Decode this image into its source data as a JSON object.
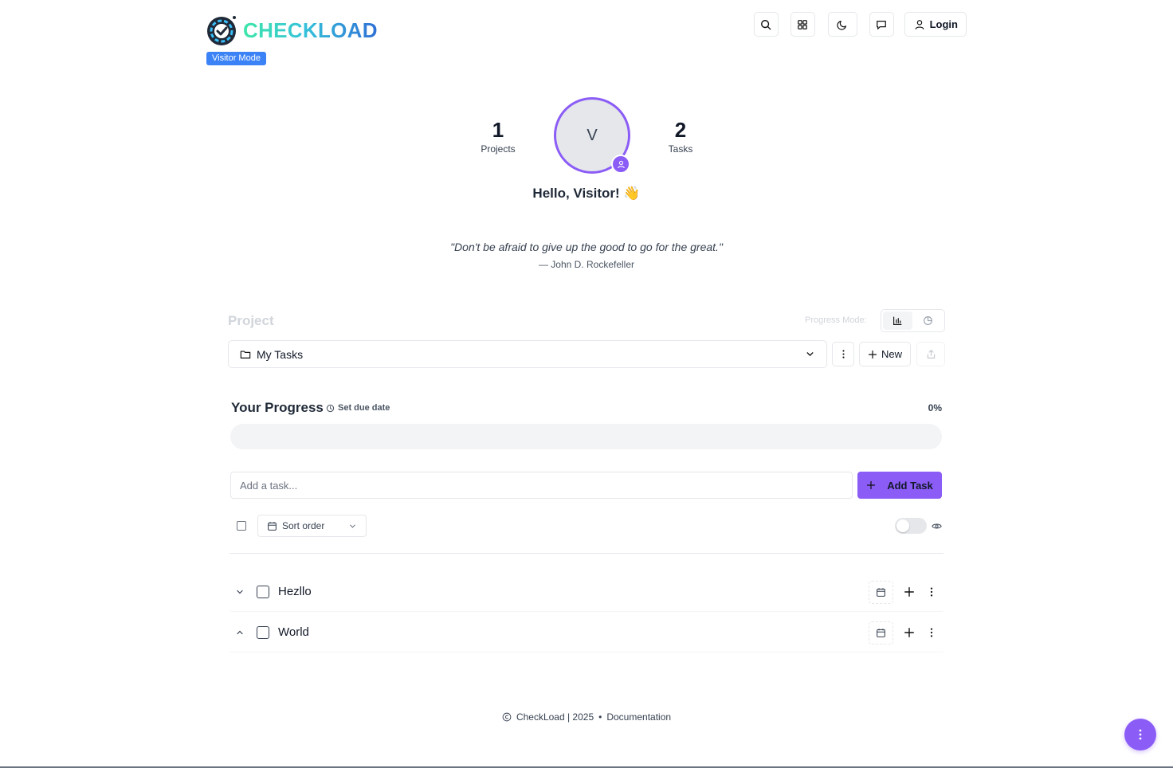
{
  "header": {
    "brand": "CHECKLOAD",
    "mode_badge": "Visitor Mode",
    "login_label": "Login"
  },
  "profile": {
    "projects_count": "1",
    "projects_label": "Projects",
    "tasks_count": "2",
    "tasks_label": "Tasks",
    "avatar_initial": "V",
    "greeting": "Hello, Visitor! 👋"
  },
  "quote": {
    "text": "\"Don't be afraid to give up the good to go for the great.\"",
    "author": "— John D. Rockefeller"
  },
  "project": {
    "label": "Project",
    "progress_mode_label": "Progress Mode:",
    "selected": "My Tasks",
    "new_label": "New"
  },
  "progress": {
    "title": "Your Progress",
    "due_date_label": "Set due date",
    "percent_text": "0%",
    "value": 0
  },
  "add_task": {
    "placeholder": "Add a task...",
    "button_label": "Add Task"
  },
  "controls": {
    "sort_label": "Sort order"
  },
  "tasks": [
    {
      "name": "Hezllo"
    },
    {
      "name": "World"
    }
  ],
  "footer": {
    "copyright": "CheckLoad | 2025",
    "separator": "•",
    "docs": "Documentation"
  },
  "colors": {
    "accent": "#8b5cf6",
    "badge": "#3b82f6"
  }
}
